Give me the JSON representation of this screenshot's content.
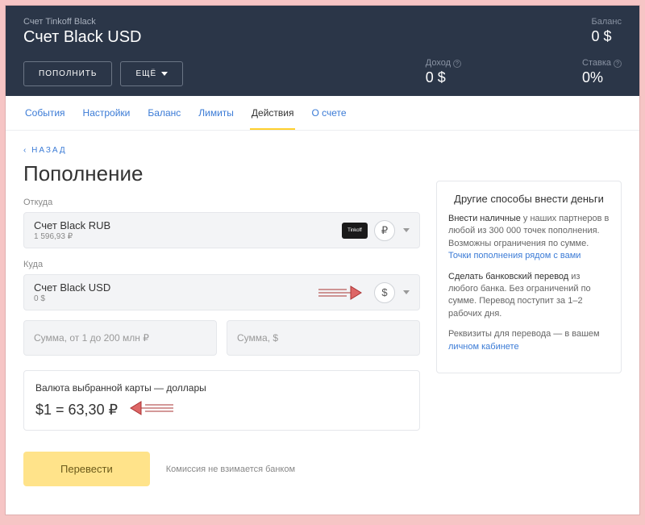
{
  "header": {
    "account_sub": "Счет Tinkoff Black",
    "account_title": "Счет Black USD",
    "balance_label": "Баланс",
    "balance_value": "0 $",
    "income_label": "Доход",
    "income_value": "0 $",
    "rate_label": "Ставка",
    "rate_value": "0%",
    "topup_btn": "ПОПОЛНИТЬ",
    "more_btn": "ЕЩЁ"
  },
  "tabs": [
    "События",
    "Настройки",
    "Баланс",
    "Лимиты",
    "Действия",
    "О счете"
  ],
  "active_tab_index": 4,
  "page": {
    "back": "НАЗАД",
    "title": "Пополнение",
    "from_label": "Откуда",
    "from_account": "Счет Black RUB",
    "from_balance": "1 596,93 ₽",
    "from_currency": "₽",
    "to_label": "Куда",
    "to_account": "Счет Black USD",
    "to_balance": "0 $",
    "to_currency": "$",
    "amount_rub_placeholder": "Сумма, от 1 до 200 млн ₽",
    "amount_usd_placeholder": "Сумма, $",
    "rate_label": "Валюта выбранной карты — доллары",
    "rate_value": "$1 = 63,30 ₽",
    "submit": "Перевести",
    "fee_note": "Комиссия не взимается банком"
  },
  "side": {
    "title": "Другие способы внести деньги",
    "cash_strong": "Внести наличные",
    "cash_text": " у наших партнеров в любой из 300 000 точек пополнения. Возможны ограничения по сумме.",
    "cash_link": "Точки пополнения рядом с вами",
    "wire_strong": "Сделать банковский перевод",
    "wire_text": " из любого банка. Без ограничений по сумме. Перевод поступит за 1–2 рабочих дня.",
    "req_text": "Реквизиты для перевода — в вашем ",
    "req_link": "личном кабинете"
  }
}
